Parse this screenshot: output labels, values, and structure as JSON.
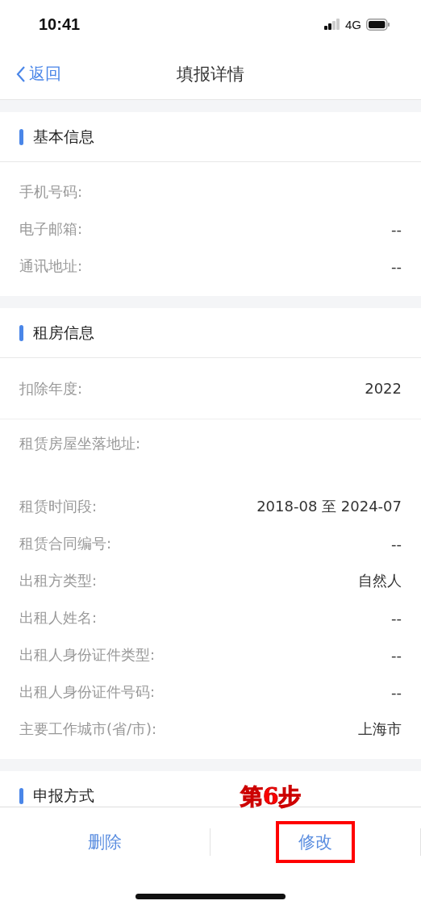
{
  "status_bar": {
    "time": "10:41",
    "network": "4G"
  },
  "nav": {
    "back": "返回",
    "title": "填报详情"
  },
  "sections": [
    {
      "title": "基本信息",
      "rows": [
        {
          "kind": "line",
          "label": "手机号码:"
        },
        {
          "kind": "line",
          "label": "电子邮箱:",
          "value": "--"
        },
        {
          "kind": "line",
          "label": "通讯地址:",
          "value": "--"
        }
      ]
    },
    {
      "title": "租房信息",
      "rows": [
        {
          "kind": "block",
          "label": "扣除年度:",
          "value": "2022"
        },
        {
          "kind": "tall",
          "label": "租赁房屋坐落地址:"
        },
        {
          "kind": "line",
          "label": "租赁时间段:",
          "value": "2018-08 至 2024-07"
        },
        {
          "kind": "line",
          "label": "租赁合同编号:",
          "value": "--"
        },
        {
          "kind": "line",
          "label": "出租方类型:",
          "value": "自然人"
        },
        {
          "kind": "line",
          "label": "出租人姓名:",
          "value": "--"
        },
        {
          "kind": "line",
          "label": "出租人身份证件类型:",
          "value": "--"
        },
        {
          "kind": "line",
          "label": "出租人身份证件号码:",
          "value": "--"
        },
        {
          "kind": "line",
          "label": "主要工作城市(省/市):",
          "value": "上海市"
        }
      ]
    },
    {
      "title": "申报方式"
    }
  ],
  "actions": [
    {
      "label": "删除",
      "highlighted": false
    },
    {
      "label": "修改",
      "highlighted": true
    }
  ],
  "annotation": {
    "text": "第6步"
  }
}
